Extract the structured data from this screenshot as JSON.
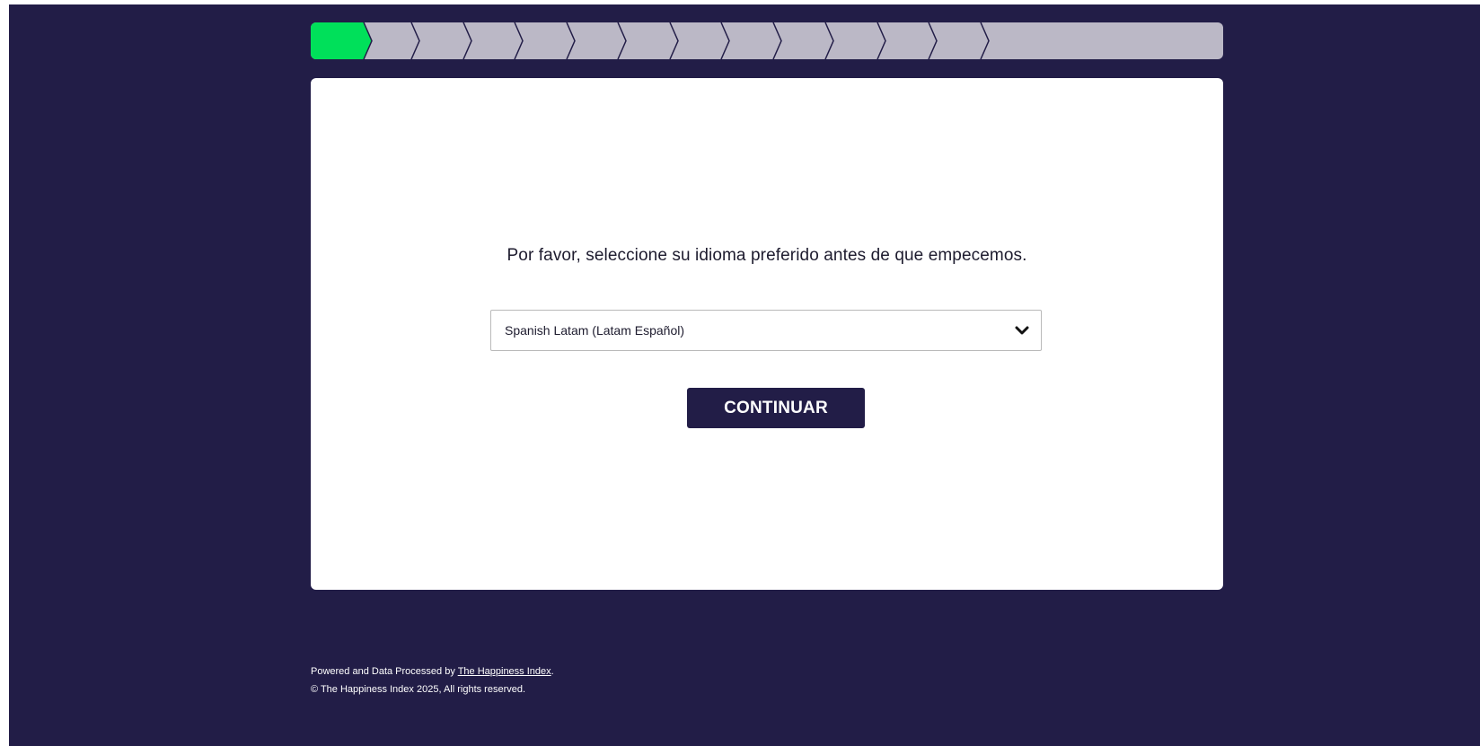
{
  "progress": {
    "total_steps": 14,
    "completed_steps": 1,
    "completed_color": "#00e05a",
    "pending_color": "#bbb8c6"
  },
  "language": {
    "prompt": "Por favor, seleccione su idioma preferido antes de que empecemos.",
    "selected_value": "Spanish Latam (Latam Español)",
    "dropdown_icon": "chevron-down-icon"
  },
  "actions": {
    "continue_label": "CONTINUAR"
  },
  "footer": {
    "powered_prefix": "Powered and Data Processed by ",
    "powered_link": "The Happiness Index",
    "powered_suffix": ".",
    "copyright": "© The Happiness Index 2025, All rights reserved."
  },
  "colors": {
    "background": "#221d47",
    "card": "#ffffff",
    "button": "#221d47"
  }
}
